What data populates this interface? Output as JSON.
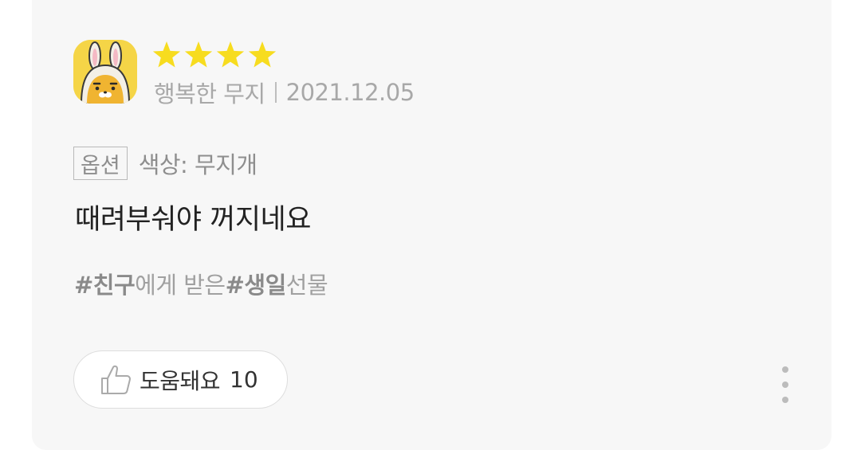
{
  "review": {
    "avatar_icon": "ryan-rabbit-avatar-icon",
    "rating": 4,
    "star_icon": "star-icon",
    "star_color": "#f7dc1f",
    "author": "행복한 무지",
    "date": "2021.12.05",
    "option_label": "옵션",
    "option_value": "색상: 무지개",
    "body": "때려부숴야 꺼지네요",
    "tags": {
      "tag1": "#친구",
      "text1": "에게 받은 ",
      "tag2": "#생일",
      "text2": " 선물"
    },
    "helpful": {
      "icon": "thumbs-up-icon",
      "label": "도움돼요",
      "count": "10"
    },
    "more_icon": "more-vertical-icon"
  },
  "colors": {
    "card_background": "#f7f7f7",
    "avatar_background": "#f5d547",
    "meta_text": "#a8a8a8",
    "body_text": "#222222"
  }
}
